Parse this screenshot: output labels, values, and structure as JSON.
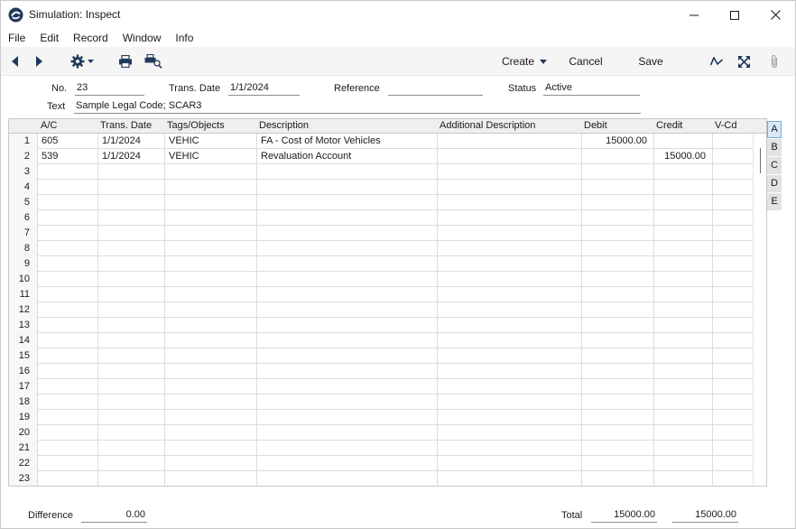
{
  "window": {
    "title": "Simulation: Inspect",
    "controls": [
      "minimize-icon",
      "maximize-icon",
      "close-icon"
    ]
  },
  "menu": {
    "items": [
      "File",
      "Edit",
      "Record",
      "Window",
      "Info"
    ]
  },
  "toolbar": {
    "create_label": "Create",
    "cancel_label": "Cancel",
    "save_label": "Save"
  },
  "header": {
    "no_label": "No.",
    "no_value": "23",
    "trans_date_label": "Trans. Date",
    "trans_date_value": "1/1/2024",
    "reference_label": "Reference",
    "reference_value": "",
    "status_label": "Status",
    "status_value": "Active",
    "text_label": "Text",
    "text_value": "Sample Legal Code; SCAR3"
  },
  "grid": {
    "columns": [
      "A/C",
      "Trans. Date",
      "Tags/Objects",
      "Description",
      "Additional Description",
      "Debit",
      "Credit",
      "V-Cd"
    ],
    "rows": [
      {
        "num": "1",
        "ac": "605",
        "date": "1/1/2024",
        "tags": "VEHIC",
        "desc": "FA - Cost of Motor Vehicles",
        "adesc": "",
        "debit": "15000.00",
        "credit": "",
        "vcd": ""
      },
      {
        "num": "2",
        "ac": "539",
        "date": "1/1/2024",
        "tags": "VEHIC",
        "desc": "Revaluation Account",
        "adesc": "",
        "debit": "",
        "credit": "15000.00",
        "vcd": ""
      },
      {
        "num": "3"
      },
      {
        "num": "4"
      },
      {
        "num": "5"
      },
      {
        "num": "6"
      },
      {
        "num": "7"
      },
      {
        "num": "8"
      },
      {
        "num": "9"
      },
      {
        "num": "10"
      },
      {
        "num": "11"
      },
      {
        "num": "12"
      },
      {
        "num": "13"
      },
      {
        "num": "14"
      },
      {
        "num": "15"
      },
      {
        "num": "16"
      },
      {
        "num": "17"
      },
      {
        "num": "18"
      },
      {
        "num": "19"
      },
      {
        "num": "20"
      },
      {
        "num": "21"
      },
      {
        "num": "22"
      },
      {
        "num": "23"
      }
    ]
  },
  "side_tabs": [
    "A",
    "B",
    "C",
    "D",
    "E"
  ],
  "side_tab_active": "A",
  "footer": {
    "difference_label": "Difference",
    "difference_value": "0.00",
    "total_label": "Total",
    "total_debit": "15000.00",
    "total_credit": "15000.00"
  },
  "colors": {
    "accent": "#7aa7d6",
    "grid_line": "#dcdcdc",
    "toolbar_bg": "#f5f5f5"
  }
}
